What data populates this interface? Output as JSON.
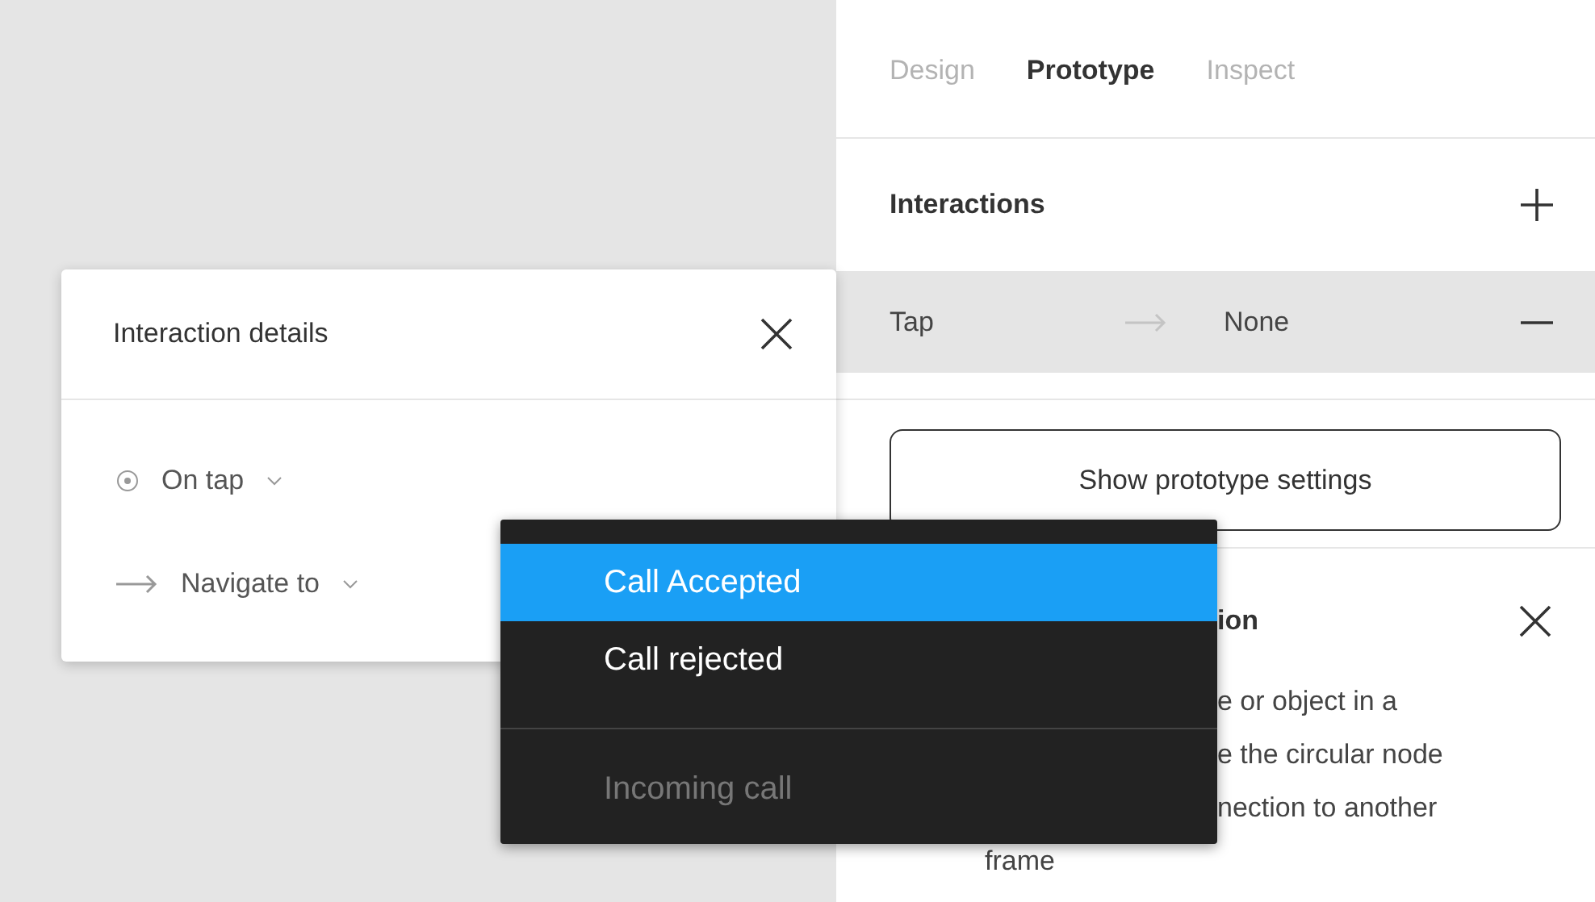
{
  "panel": {
    "tabs": [
      {
        "label": "Design",
        "selected": false
      },
      {
        "label": "Prototype",
        "selected": true
      },
      {
        "label": "Inspect",
        "selected": false
      }
    ],
    "interactions": {
      "title": "Interactions",
      "rows": [
        {
          "trigger": "Tap",
          "target": "None",
          "selected": true
        }
      ]
    },
    "settings_button": "Show prototype settings",
    "hint": {
      "title": "ion",
      "lines": [
        {
          "text": "e or object in a",
          "kind": "covered"
        },
        {
          "text": "e the circular node",
          "kind": "covered"
        },
        {
          "text": "nection to another",
          "kind": "covered"
        },
        {
          "text": "frame",
          "kind": "open"
        }
      ]
    }
  },
  "details": {
    "title": "Interaction details",
    "trigger": "On tap",
    "action": "Navigate to"
  },
  "menu": {
    "items": [
      {
        "label": "Call Accepted",
        "selected": true,
        "disabled": false
      },
      {
        "label": "Call rejected",
        "selected": false,
        "disabled": false
      },
      {
        "label": "Incoming call",
        "selected": false,
        "disabled": true
      }
    ]
  }
}
